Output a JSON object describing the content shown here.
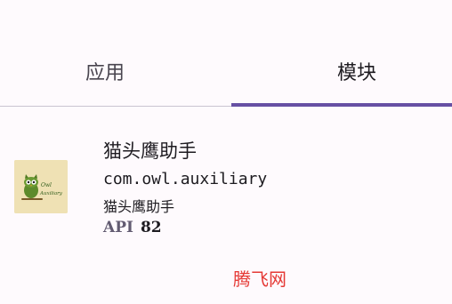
{
  "tabs": [
    {
      "label": "应用",
      "selected": false
    },
    {
      "label": "模块",
      "selected": true
    }
  ],
  "colors": {
    "background": "#fefafd",
    "indicator": "#6750a4",
    "divider": "#cac4d0",
    "watermark": "#e53935"
  },
  "module": {
    "icon": "owl-auxiliary-app-icon",
    "icon_text": "Owl Auxiliary",
    "name": "猫头鹰助手",
    "package": "com.owl.auxiliary",
    "description": "猫头鹰助手",
    "api_label": "API",
    "api_value": "82"
  },
  "watermark": {
    "text": "腾飞网"
  }
}
